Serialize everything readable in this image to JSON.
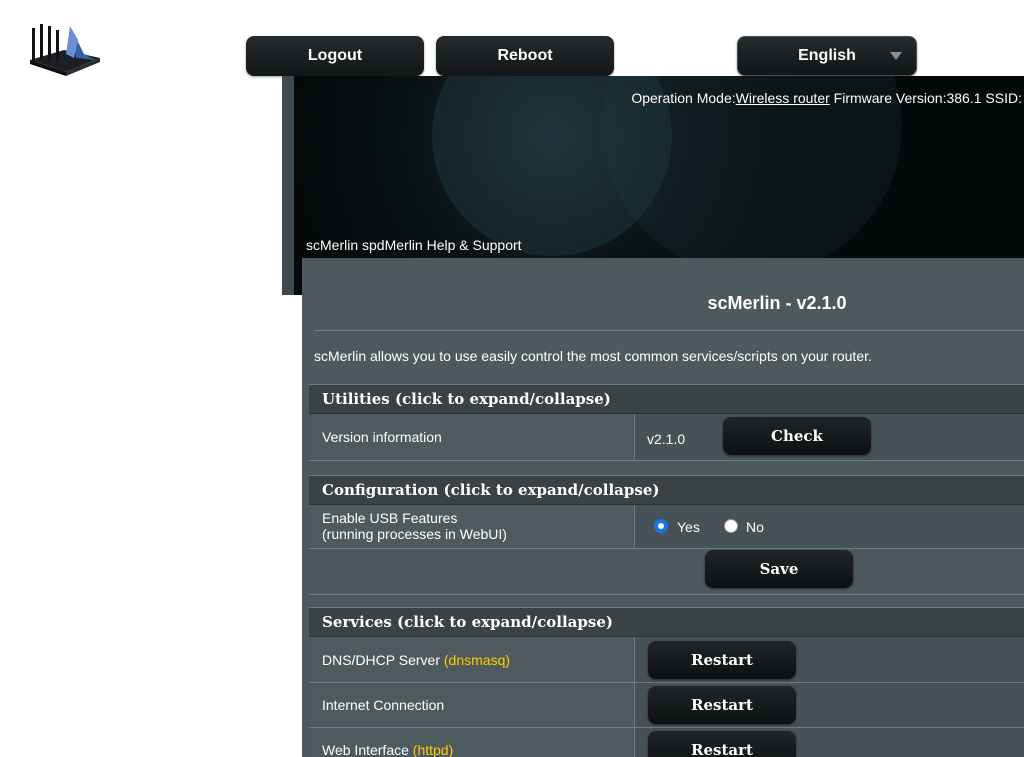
{
  "header": {
    "logout_label": "Logout",
    "reboot_label": "Reboot",
    "language": "English"
  },
  "banner": {
    "op_mode_label": "Operation Mode:",
    "op_mode_value": "Wireless router",
    "firmware_label": "Firmware Version:",
    "firmware_value": "386.1",
    "ssid_label": "SSID:",
    "menu_items": [
      "scMerlin",
      "spdMerlin",
      "Help & Support"
    ]
  },
  "page": {
    "title": "scMerlin - v2.1.0",
    "description": "scMerlin allows you to use easily control the most common services/scripts on your router."
  },
  "utilities": {
    "heading": "Utilities (click to expand/collapse)",
    "version_label": "Version information",
    "version_value": "v2.1.0",
    "check_label": "Check"
  },
  "configuration": {
    "heading": "Configuration (click to expand/collapse)",
    "usb_label": "Enable USB Features",
    "usb_note": "(running processes in WebUI)",
    "yes_label": "Yes",
    "no_label": "No",
    "selected": "Yes",
    "save_label": "Save"
  },
  "services": {
    "heading": "Services (click to expand/collapse)",
    "items": [
      {
        "label": "DNS/DHCP Server",
        "note": "(dnsmasq)",
        "button": "Restart"
      },
      {
        "label": "Internet Connection",
        "note": "",
        "button": "Restart"
      },
      {
        "label": "Web Interface",
        "note": "(httpd)",
        "button": "Restart"
      }
    ]
  },
  "colors": {
    "accent_note": "#ffcc00",
    "radio_selected": "#1a73e8",
    "panel_bg": "#4d595d"
  }
}
